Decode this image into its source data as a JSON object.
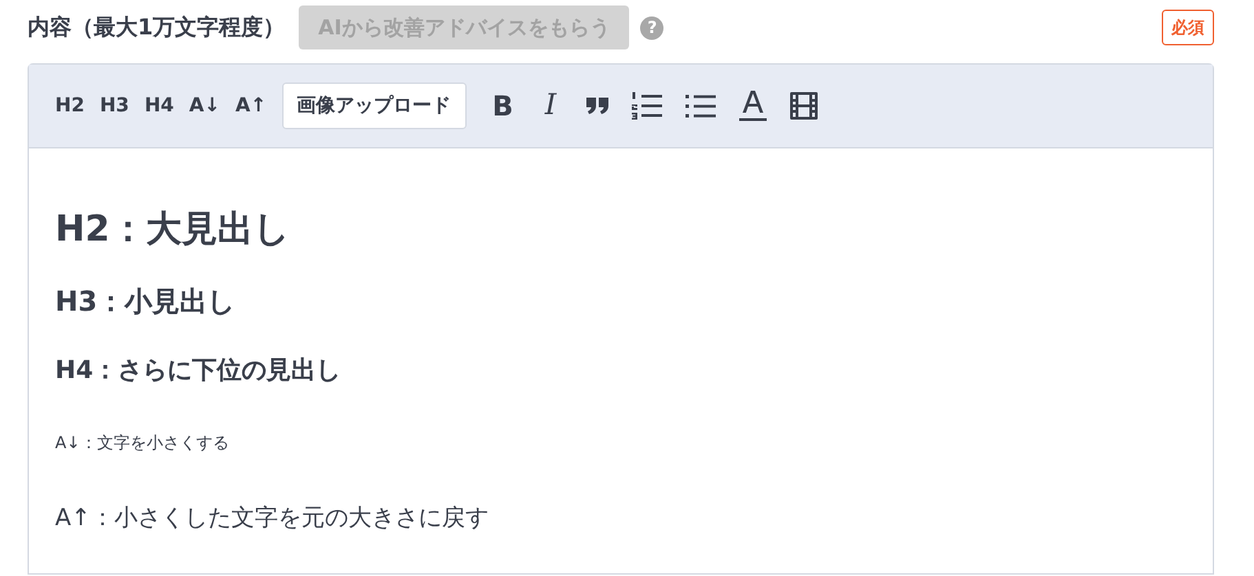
{
  "field": {
    "label": "内容（最大1万文字程度）",
    "ai_button": {
      "label": "AIから改善アドバイスをもらう",
      "disabled": true
    },
    "help": "?",
    "required_badge": "必須"
  },
  "toolbar": [
    {
      "kind": "text",
      "label": "H2"
    },
    {
      "kind": "text",
      "label": "H3"
    },
    {
      "kind": "text",
      "label": "H4"
    },
    {
      "kind": "text",
      "label": "A↓"
    },
    {
      "kind": "text",
      "label": "A↑"
    },
    {
      "kind": "upload",
      "label": "画像アップロード"
    },
    {
      "kind": "bold",
      "label": "B"
    },
    {
      "kind": "italic",
      "label": "I"
    },
    {
      "kind": "quote"
    },
    {
      "kind": "ordered-list"
    },
    {
      "kind": "bullet-list"
    },
    {
      "kind": "font-color"
    },
    {
      "kind": "video"
    }
  ],
  "content": [
    {
      "kind": "h2",
      "text": "H2：大見出し"
    },
    {
      "kind": "h3",
      "text": "H3：小見出し"
    },
    {
      "kind": "h4",
      "text": "H4：さらに下位の見出し"
    },
    {
      "kind": "small",
      "text": "A↓：文字を小さくする"
    },
    {
      "kind": "normal",
      "text": "A↑：小さくした文字を元の大きさに戻す"
    }
  ]
}
